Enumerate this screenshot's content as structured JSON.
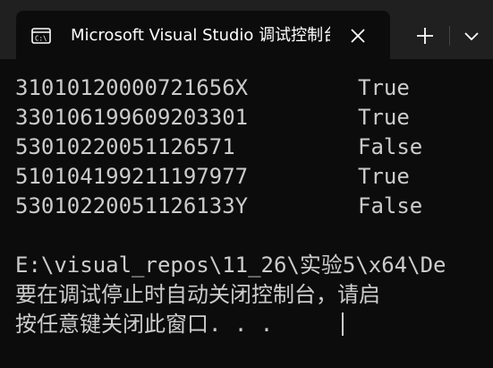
{
  "tab": {
    "icon": "console-app-icon",
    "title": "Microsoft Visual Studio 调试控制台"
  },
  "controls": {
    "close_icon": "close-icon",
    "new_tab_icon": "plus-icon",
    "dropdown_icon": "chevron-down-icon"
  },
  "console": {
    "results": [
      {
        "id": "31010120000721656X",
        "value": "True"
      },
      {
        "id": "330106199609203301",
        "value": "True"
      },
      {
        "id": "53010220051126571",
        "value": "False"
      },
      {
        "id": "510104199211197977",
        "value": "True"
      },
      {
        "id": "53010220051126133Y",
        "value": "False"
      }
    ],
    "path_line": "E:\\visual_repos\\11_26\\实验5\\x64\\De",
    "message_line": "要在调试停止时自动关闭控制台，请启",
    "prompt_line": "按任意键关闭此窗口. . ."
  }
}
